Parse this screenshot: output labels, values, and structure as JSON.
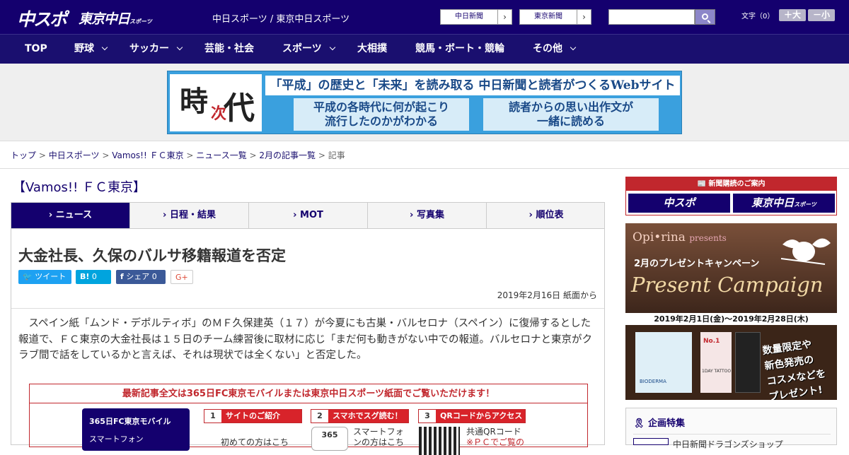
{
  "header": {
    "logo_main": "中スポ",
    "logo_sub": "東京中日",
    "logo_sub_small": "スポーツ",
    "site_name": "中日スポーツ / 東京中日スポーツ",
    "links": [
      "中日新聞",
      "東京新聞"
    ],
    "search_placeholder": "",
    "font_label": "文字（0）",
    "font_larger": "＋大",
    "font_smaller": "－小"
  },
  "nav": {
    "items": [
      {
        "label": "TOP",
        "dropdown": false
      },
      {
        "label": "野球",
        "dropdown": true
      },
      {
        "label": "サッカー",
        "dropdown": true
      },
      {
        "label": "芸能・社会",
        "dropdown": false
      },
      {
        "label": "スポーツ",
        "dropdown": true
      },
      {
        "label": "大相撲",
        "dropdown": false
      },
      {
        "label": "競馬・ボート・競輪",
        "dropdown": false
      },
      {
        "label": "その他",
        "dropdown": true
      }
    ]
  },
  "banner": {
    "logo_chars": [
      "時",
      "次",
      "代"
    ],
    "headline": "「平成」の歴史と「未来」を読み取る 中日新聞と読者がつくるWebサイト",
    "box1": [
      "平成の各時代に何が起こり",
      "流行したのかがわかる"
    ],
    "box2": [
      "読者からの思い出作文が",
      "一緒に読める"
    ]
  },
  "breadcrumb": {
    "items": [
      "トップ",
      "中日スポーツ",
      "Vamos!! ＦＣ東京",
      "ニュース一覧",
      "2月の記事一覧"
    ],
    "current": "記事",
    "separator": ">"
  },
  "section_title": "【Vamos!! ＦＣ東京】",
  "tabs": [
    {
      "label": "ニュース",
      "active": true
    },
    {
      "label": "日程・結果",
      "active": false
    },
    {
      "label": "MOT",
      "active": false
    },
    {
      "label": "写真集",
      "active": false
    },
    {
      "label": "順位表",
      "active": false
    }
  ],
  "article": {
    "title": "大金社長、久保のバルサ移籍報道を否定",
    "share": {
      "tweet": "ツイート",
      "hatena": "B!",
      "hatena_count": "0",
      "fb": "シェア",
      "fb_count": "0",
      "gplus": "G+"
    },
    "date": "2019年2月16日 紙面から",
    "body": "スペイン紙「ムンド・デポルティボ」のＭＦ久保建英（１７）が今夏にも古巣・バルセロナ（スペイン）に復帰するとした報道で、ＦＣ東京の大金社長は１５日のチーム練習後に取材に応じ「まだ何も動きがない中での報道。バルセロナと東京がクラブ間で話をしているかと言えば、それは現状では全くない」と否定した。"
  },
  "promo": {
    "headline": "最新記事全文は365日FC東京モバイルまたは東京中日スポーツ紙面でご覧いただけます！",
    "mobile_title": "365日FC東京モバイル",
    "mobile_sub": "スマートフォン",
    "steps": [
      {
        "num": "1",
        "label": "サイトのご紹介",
        "text": "初めての方はこち"
      },
      {
        "num": "2",
        "label": "スマホでスグ読む！",
        "text1": "スマートフォ",
        "text2": "ンの方はこち",
        "logo": "365"
      },
      {
        "num": "3",
        "label": "QRコードからアクセス",
        "text1": "共通QRコード",
        "text2": "※ＰＣでご覧の"
      }
    ]
  },
  "sidebar": {
    "subscribe": {
      "header": "新聞購読のご案内",
      "left": "中スポ",
      "right": "東京中日",
      "right_small": "スポーツ"
    },
    "ad": {
      "brand": "Opi•rina",
      "brand_suffix": "presents",
      "campaign": "2月のプレゼントキャンペーン",
      "big": "Present Campaign",
      "dates": "2019年2月1日(金)～2019年2月28日(木)",
      "promo_lines": [
        "数量限定や",
        "新色発売の",
        "コスメなどを",
        "プレゼント!"
      ],
      "product_labels": [
        "BIODERMA",
        "No.1",
        "1DAY TATTOO"
      ]
    },
    "feature": {
      "title": "企画特集",
      "item": "中日新聞ドラゴンズショップ"
    }
  },
  "colors": {
    "navy": "#14006e",
    "red": "#c1272d",
    "twitter": "#1da1f2",
    "hatena": "#00a4de",
    "facebook": "#3b5998"
  }
}
